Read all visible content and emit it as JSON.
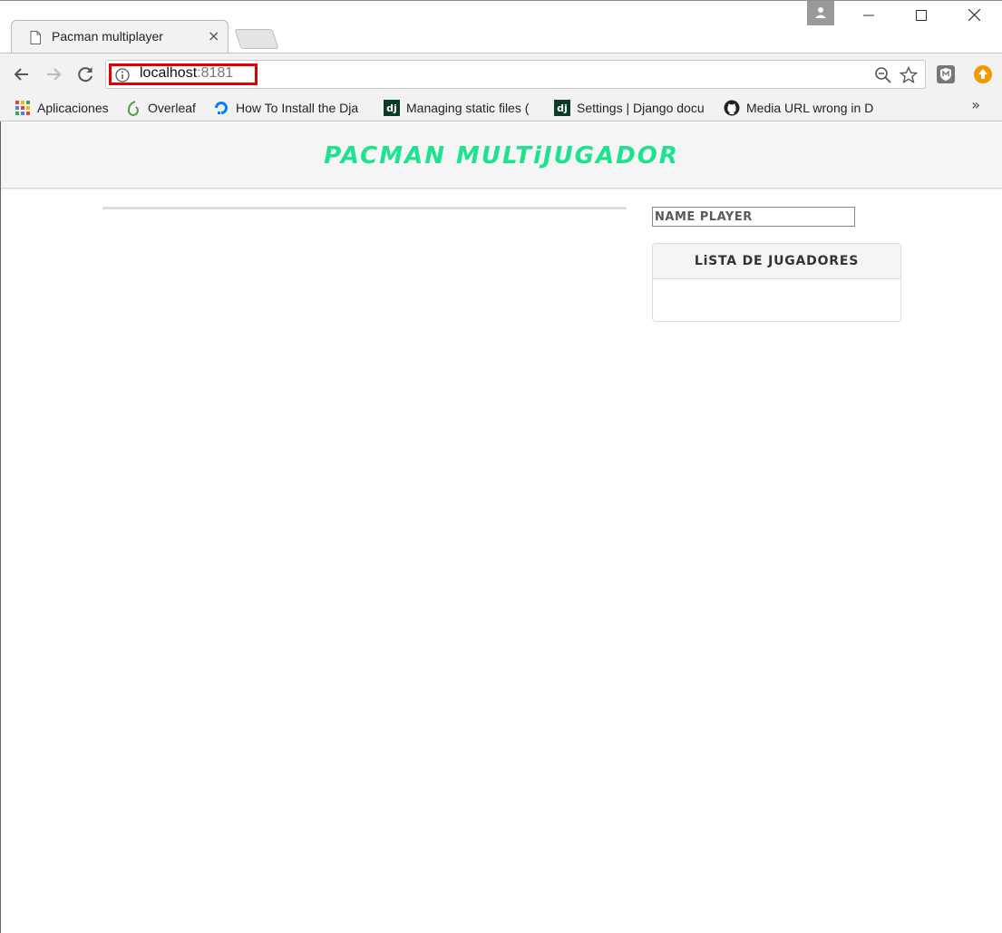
{
  "browser": {
    "tab_title": "Pacman multiplayer",
    "tab_close": "×",
    "url_host": "localhost",
    "url_port": ":8181",
    "window_controls": {
      "minimize": "—",
      "maximize": "☐",
      "close": "✕"
    },
    "bookmarks": [
      {
        "label": "Aplicaciones",
        "icon": "apps-grid-icon"
      },
      {
        "label": "Overleaf",
        "icon": "overleaf-icon"
      },
      {
        "label": "How To Install the Dja",
        "icon": "digitalocean-icon"
      },
      {
        "label": "Managing static files (",
        "icon": "django-icon"
      },
      {
        "label": "Settings | Django docu",
        "icon": "django-icon"
      },
      {
        "label": "Media URL wrong in D",
        "icon": "github-icon"
      }
    ],
    "bookmarks_more": "»",
    "django_badge": "dj"
  },
  "page": {
    "title": "PACMAN MULTiJUGADOR",
    "name_placeholder": "NAME PLAYER",
    "players_panel_title": "LiSTA DE JUGADORES"
  },
  "colors": {
    "title": "#1de28e",
    "url_highlight": "#e00000",
    "extension_orange": "#f29900"
  }
}
